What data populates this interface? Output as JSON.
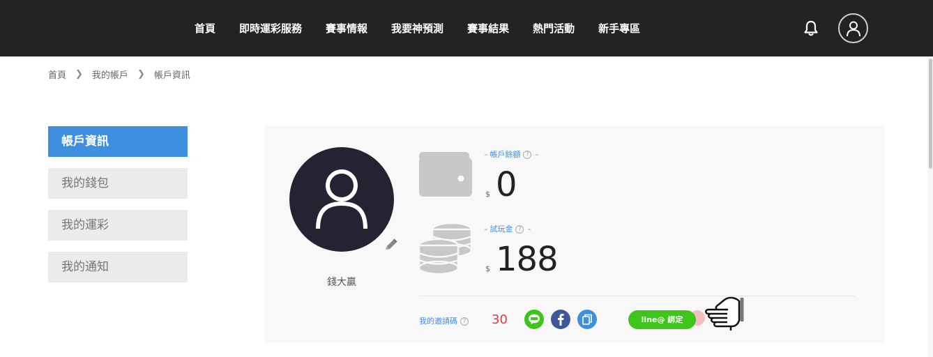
{
  "nav": {
    "items": [
      "首頁",
      "即時運彩服務",
      "賽事情報",
      "我要神預測",
      "賽事結果",
      "熱門活動",
      "新手專區"
    ],
    "icons": [
      "bell-icon",
      "user-avatar-icon"
    ]
  },
  "breadcrumb": [
    "首頁",
    "我的帳戶",
    "帳戶資訊"
  ],
  "sidebar": {
    "items": [
      {
        "label": "帳戶資訊",
        "active": true
      },
      {
        "label": "我的錢包",
        "active": false
      },
      {
        "label": "我的運彩",
        "active": false
      },
      {
        "label": "我的通知",
        "active": false
      }
    ]
  },
  "profile": {
    "username": "錢大贏"
  },
  "account": {
    "balance_label": "帳戶餘額",
    "balance_currency": "$",
    "balance_value": "0",
    "trial_label": "試玩金",
    "trial_currency": "$",
    "trial_value": "188",
    "help_mark": "?",
    "label_dash": "-"
  },
  "invite": {
    "label": "我的邀請碼",
    "code": "30",
    "share_icons": [
      "line-icon",
      "facebook-icon",
      "copy-icon"
    ],
    "bind_button": "line@ 綁定"
  },
  "colors": {
    "topbar": "#232323",
    "accent": "#3f8fe0",
    "invite_code": "#e33b3b",
    "line_green": "#3ec51c",
    "facebook_blue": "#3b5998",
    "copy_blue": "#3f8fe0"
  }
}
